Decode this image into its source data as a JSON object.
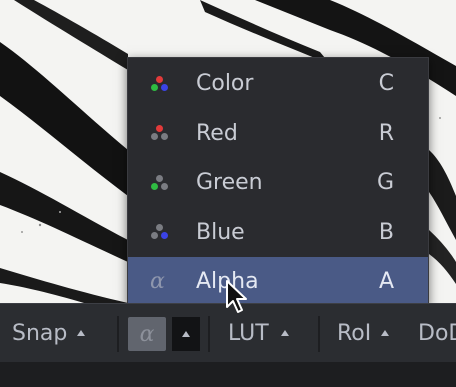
{
  "channel_menu": {
    "items": [
      {
        "label": "Color",
        "key": "C",
        "icon": "rgb-channels-icon",
        "colors": [
          "#e23a3a",
          "#2fbb42",
          "#3b43e6"
        ]
      },
      {
        "label": "Red",
        "key": "R",
        "icon": "red-channel-icon",
        "colors": [
          "#e23a3a",
          "#7a7c82",
          "#7a7c82"
        ]
      },
      {
        "label": "Green",
        "key": "G",
        "icon": "green-channel-icon",
        "colors": [
          "#7a7c82",
          "#2fbb42",
          "#7a7c82"
        ]
      },
      {
        "label": "Blue",
        "key": "B",
        "icon": "blue-channel-icon",
        "colors": [
          "#7a7c82",
          "#7a7c82",
          "#3b43e6"
        ]
      },
      {
        "label": "Alpha",
        "key": "A",
        "icon": "alpha-channel-icon",
        "glyph": "α",
        "selected": true
      }
    ]
  },
  "toolbar": {
    "snap_label": "Snap",
    "channel_glyph": "α",
    "lut_label": "LUT",
    "roi_label": "RoI",
    "dod_label": "DoD"
  },
  "colors": {
    "menu_bg": "#2a2b2f",
    "selected_bg": "#4a5a86",
    "toolbar_bg": "#2b2d31"
  }
}
